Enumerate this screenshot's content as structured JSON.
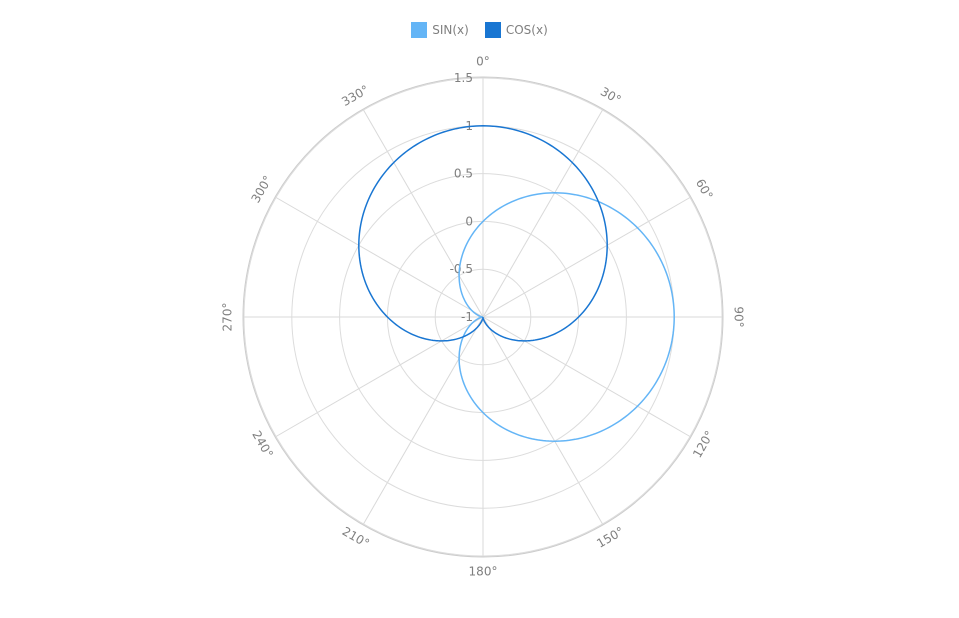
{
  "legend": {
    "items": [
      {
        "label": "SIN(x)",
        "color": "#64b5f6"
      },
      {
        "label": "COS(x)",
        "color": "#1976d2"
      }
    ]
  },
  "chart_data": {
    "type": "line",
    "coordinate_system": "polar",
    "angular_axis": {
      "start": "top",
      "direction": "clockwise",
      "unit": "degrees",
      "tick_labels": [
        "0°",
        "30°",
        "60°",
        "90°",
        "120°",
        "150°",
        "180°",
        "210°",
        "240°",
        "270°",
        "300°",
        "330°"
      ]
    },
    "radial_axis": {
      "range": [
        -1,
        1.5
      ],
      "tick_labels": [
        "-1",
        "-0.5",
        "0",
        "0.5",
        "1",
        "1.5"
      ]
    },
    "grid": true,
    "legend_position": "top-center",
    "series": [
      {
        "name": "SIN(x)",
        "color": "#64b5f6",
        "function": "sin",
        "theta": [
          0,
          360
        ],
        "r_range": [
          -1,
          1
        ]
      },
      {
        "name": "COS(x)",
        "color": "#1976d2",
        "function": "cos",
        "theta": [
          0,
          360
        ],
        "r_range": [
          -1,
          1
        ]
      }
    ]
  }
}
